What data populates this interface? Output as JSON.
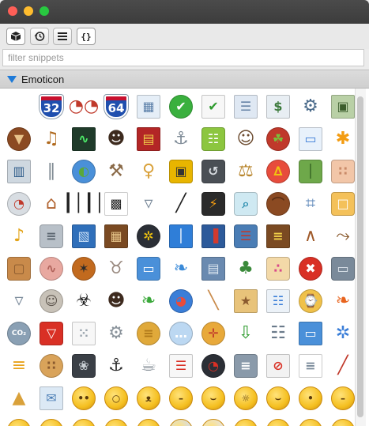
{
  "window": {
    "traffic_lights": [
      "close",
      "minimize",
      "maximize"
    ]
  },
  "toolbar": {
    "tabs": [
      {
        "icon": "cube-icon",
        "active": true
      },
      {
        "icon": "history-icon",
        "active": false
      },
      {
        "icon": "list-icon",
        "active": false
      },
      {
        "icon": "json-icon",
        "glyph": "{}",
        "active": true
      }
    ]
  },
  "filter": {
    "placeholder": "filter snippets",
    "value": ""
  },
  "section": {
    "title": "Emoticon",
    "expanded": true
  },
  "icons": [
    {
      "name": "blank-icon",
      "kind": "none"
    },
    {
      "name": "interstate-32-shield-icon",
      "kind": "shield",
      "text": "32",
      "bg": "#1f4fae",
      "fg": "#c8102e"
    },
    {
      "name": "3d-glasses-icon",
      "kind": "glyph",
      "glyph": "◔◔",
      "bg": "transparent",
      "fg": "#c0392b"
    },
    {
      "name": "interstate-64-shield-icon",
      "kind": "shield",
      "text": "64",
      "bg": "#1f4fae",
      "fg": "#c8102e"
    },
    {
      "name": "circuit-board-icon",
      "kind": "card",
      "bg": "#e5eef7",
      "fg": "#5b7fa8",
      "glyph": "▦"
    },
    {
      "name": "green-check-icon",
      "kind": "round",
      "bg": "#3ab03e",
      "fg": "#ffffff",
      "glyph": "✔"
    },
    {
      "name": "document-check-icon",
      "kind": "card",
      "bg": "#f7f7f7",
      "fg": "#2e9b2e",
      "glyph": "✔"
    },
    {
      "name": "table-rows-icon",
      "kind": "card",
      "bg": "#dfe8f3",
      "fg": "#6683a6",
      "glyph": "☰"
    },
    {
      "name": "people-money-icon",
      "kind": "card",
      "bg": "#e8eef3",
      "fg": "#3c7a3c",
      "glyph": "$"
    },
    {
      "name": "user-gear-icon",
      "kind": "glyph",
      "bg": "transparent",
      "fg": "#4a6a8a",
      "glyph": "⚙"
    },
    {
      "name": "user-photos-icon",
      "kind": "card",
      "bg": "#b9d0a6",
      "fg": "#3b5d2c",
      "glyph": "▣"
    },
    {
      "name": "acorn-icon",
      "kind": "round",
      "bg": "#8b4a22",
      "fg": "#e8c38a",
      "glyph": "▼"
    },
    {
      "name": "guitar-icon",
      "kind": "glyph",
      "bg": "transparent",
      "fg": "#b06a1f",
      "glyph": "♫"
    },
    {
      "name": "heart-monitor-icon",
      "kind": "card",
      "bg": "#1f3b2a",
      "fg": "#4ef06a",
      "glyph": "∿"
    },
    {
      "name": "businessman-icon",
      "kind": "glyph",
      "bg": "transparent",
      "fg": "#3d2a1e",
      "glyph": "☻"
    },
    {
      "name": "network-card-icon",
      "kind": "card",
      "bg": "#b32626",
      "fg": "#f2d24a",
      "glyph": "▤"
    },
    {
      "name": "anchor-icon",
      "kind": "glyph",
      "bg": "transparent",
      "fg": "#7d8a96",
      "glyph": "⚓"
    },
    {
      "name": "android-robot-icon",
      "kind": "sq",
      "bg": "#8cc63f",
      "fg": "#ffffff",
      "glyph": "☷"
    },
    {
      "name": "nurse-icon",
      "kind": "glyph",
      "bg": "transparent",
      "fg": "#6b4a2e",
      "glyph": "☺"
    },
    {
      "name": "apple-icon",
      "kind": "round",
      "bg": "#c0392b",
      "fg": "#7bbf3a",
      "glyph": "☘"
    },
    {
      "name": "window-icon",
      "kind": "card",
      "bg": "#e8f1fb",
      "fg": "#3b7dd8",
      "glyph": "▭"
    },
    {
      "name": "asterisk-icon",
      "kind": "glyph",
      "bg": "transparent",
      "fg": "#f39c12",
      "glyph": "✱"
    },
    {
      "name": "atm-machine-icon",
      "kind": "card",
      "bg": "#cfd8e0",
      "fg": "#2e5c8a",
      "glyph": "▥"
    },
    {
      "name": "paperclip-icon",
      "kind": "glyph",
      "bg": "transparent",
      "fg": "#7f8a93",
      "glyph": "∥"
    },
    {
      "name": "globe-chart-icon",
      "kind": "round",
      "bg": "#4a90d9",
      "fg": "#5aa83a",
      "glyph": "◐"
    },
    {
      "name": "axe-icon",
      "kind": "glyph",
      "bg": "transparent",
      "fg": "#8a6a48",
      "glyph": "⚒"
    },
    {
      "name": "baby-bottle-icon",
      "kind": "glyph",
      "bg": "transparent",
      "fg": "#d9a13a",
      "glyph": "♀"
    },
    {
      "name": "backpack-icon",
      "kind": "sq",
      "bg": "#e8b500",
      "fg": "#333333",
      "glyph": "▣"
    },
    {
      "name": "time-machine-disk-icon",
      "kind": "sq",
      "bg": "#4a4f55",
      "fg": "#d7dbe0",
      "glyph": "↺"
    },
    {
      "name": "balance-scale-icon",
      "kind": "glyph",
      "bg": "transparent",
      "fg": "#b8862e",
      "glyph": "⚖"
    },
    {
      "name": "hot-air-balloon-icon",
      "kind": "round",
      "bg": "#e74c3c",
      "fg": "#f1c40f",
      "glyph": "∆"
    },
    {
      "name": "bamboo-icon",
      "kind": "sq",
      "bg": "#6ea84a",
      "fg": "#2e5a1e",
      "glyph": "│"
    },
    {
      "name": "bandage-icon",
      "kind": "sq",
      "bg": "#f2c6a8",
      "fg": "#c98a68",
      "glyph": "∷"
    },
    {
      "name": "pressure-gauge-icon",
      "kind": "round",
      "bg": "#d8dde2",
      "fg": "#c0392b",
      "glyph": "◔"
    },
    {
      "name": "bank-building-icon",
      "kind": "glyph",
      "bg": "transparent",
      "fg": "#b0622e",
      "glyph": "⌂"
    },
    {
      "name": "barcode-icon",
      "kind": "glyph",
      "bg": "transparent",
      "fg": "#222222",
      "glyph": "┃│┃│"
    },
    {
      "name": "qr-code-icon",
      "kind": "card",
      "bg": "#ffffff",
      "fg": "#222222",
      "glyph": "▩"
    },
    {
      "name": "shopping-basket-icon",
      "kind": "glyph",
      "bg": "transparent",
      "fg": "#7a8a9a",
      "glyph": "▿"
    },
    {
      "name": "baton-icon",
      "kind": "glyph",
      "bg": "transparent",
      "fg": "#222222",
      "glyph": "╱"
    },
    {
      "name": "battery-icon",
      "kind": "sq",
      "bg": "#2b2b2b",
      "fg": "#f39c12",
      "glyph": "⚡"
    },
    {
      "name": "beaker-icon",
      "kind": "sq",
      "bg": "#cfe9f2",
      "fg": "#2e8fb0",
      "glyph": "⌕"
    },
    {
      "name": "bean-icon",
      "kind": "round",
      "bg": "#8b4a22",
      "fg": "#5a2e14",
      "glyph": "⌒"
    },
    {
      "name": "bed-icon",
      "kind": "glyph",
      "bg": "transparent",
      "fg": "#5b86b8",
      "glyph": "⌗"
    },
    {
      "name": "beer-glass-icon",
      "kind": "sq",
      "bg": "#f4c15a",
      "fg": "#ffffff",
      "glyph": "□"
    },
    {
      "name": "bell-icon",
      "kind": "glyph",
      "bg": "transparent",
      "fg": "#e3a41a",
      "glyph": "♪"
    },
    {
      "name": "garbage-bin-icon",
      "kind": "sq",
      "bg": "#b8c0c8",
      "fg": "#5b6670",
      "glyph": "≡"
    },
    {
      "name": "blueprint-icon",
      "kind": "card",
      "bg": "#2f6fba",
      "fg": "#cde2f7",
      "glyph": "▧"
    },
    {
      "name": "board-game-icon",
      "kind": "card",
      "bg": "#7a4a22",
      "fg": "#e7c58a",
      "glyph": "▦"
    },
    {
      "name": "bomb-icon",
      "kind": "round",
      "bg": "#2b2f36",
      "fg": "#f1c40f",
      "glyph": "✲"
    },
    {
      "name": "blue-book-icon",
      "kind": "card",
      "bg": "#2f7ed8",
      "fg": "#ffffff",
      "glyph": "│"
    },
    {
      "name": "book-red-bookmark-icon",
      "kind": "card",
      "bg": "#2d5a9a",
      "fg": "#d33a2e",
      "glyph": "▐"
    },
    {
      "name": "books-stack-icon",
      "kind": "sq",
      "bg": "#4a7db5",
      "fg": "#c0392b",
      "glyph": "☰"
    },
    {
      "name": "bookshelf-icon",
      "kind": "card",
      "bg": "#7a4a22",
      "fg": "#f2d24a",
      "glyph": "≡"
    },
    {
      "name": "boomerang-icon",
      "kind": "glyph",
      "bg": "transparent",
      "fg": "#a05a2a",
      "glyph": "∧"
    },
    {
      "name": "bow-arrow-icon",
      "kind": "glyph",
      "bg": "transparent",
      "fg": "#8a5a2e",
      "glyph": "⤳"
    },
    {
      "name": "wooden-box-icon",
      "kind": "sq",
      "bg": "#c98a4a",
      "fg": "#8a5a2e",
      "glyph": "▢"
    },
    {
      "name": "brain-icon",
      "kind": "round",
      "bg": "#e8a8a0",
      "fg": "#b0625a",
      "glyph": "∿"
    },
    {
      "name": "bug-icon",
      "kind": "round",
      "bg": "#c26a1e",
      "fg": "#2b2b2b",
      "glyph": "✶"
    },
    {
      "name": "bunny-icon",
      "kind": "glyph",
      "bg": "transparent",
      "fg": "#9a8a80",
      "glyph": "♉"
    },
    {
      "name": "bus-icon",
      "kind": "sq",
      "bg": "#4a90d9",
      "fg": "#ffffff",
      "glyph": "▭"
    },
    {
      "name": "butterfly-icon",
      "kind": "glyph",
      "bg": "transparent",
      "fg": "#3a8ad8",
      "glyph": "❧"
    },
    {
      "name": "building-icon",
      "kind": "card",
      "bg": "#6a8ab0",
      "fg": "#dce6f0",
      "glyph": "▤"
    },
    {
      "name": "cactus-icon",
      "kind": "glyph",
      "bg": "transparent",
      "fg": "#3a8a3a",
      "glyph": "♣"
    },
    {
      "name": "birthday-cake-icon",
      "kind": "sq",
      "bg": "#f3d9a8",
      "fg": "#d94a8a",
      "glyph": "∴"
    },
    {
      "name": "cancel-icon",
      "kind": "round",
      "bg": "#d93025",
      "fg": "#ffffff",
      "glyph": "✖"
    },
    {
      "name": "car-icon",
      "kind": "sq",
      "bg": "#7a8a9a",
      "fg": "#dfe6ec",
      "glyph": "▭"
    },
    {
      "name": "shopping-cart-icon",
      "kind": "glyph",
      "bg": "transparent",
      "fg": "#7a8a9a",
      "glyph": "▿"
    },
    {
      "name": "cat-icon",
      "kind": "round",
      "bg": "#c8c2b8",
      "fg": "#5a524a",
      "glyph": "☺"
    },
    {
      "name": "biohazard-icon",
      "kind": "glyph",
      "bg": "transparent",
      "fg": "#222222",
      "glyph": "☣"
    },
    {
      "name": "manager-icon",
      "kind": "glyph",
      "bg": "transparent",
      "fg": "#3d2a1e",
      "glyph": "☻"
    },
    {
      "name": "chameleon-icon",
      "kind": "glyph",
      "bg": "transparent",
      "fg": "#3aa83a",
      "glyph": "❧"
    },
    {
      "name": "pie-chart-icon",
      "kind": "round",
      "bg": "#3a7ed8",
      "fg": "#e74c3c",
      "glyph": "◕"
    },
    {
      "name": "cigarette-icon",
      "kind": "glyph",
      "bg": "transparent",
      "fg": "#c98a4a",
      "glyph": "╲"
    },
    {
      "name": "cinema-ticket-icon",
      "kind": "card",
      "bg": "#e8c37a",
      "fg": "#8a5a2e",
      "glyph": "★"
    },
    {
      "name": "network-diagram-icon",
      "kind": "card",
      "bg": "#ecf2f8",
      "fg": "#3a7ed8",
      "glyph": "☷"
    },
    {
      "name": "alarm-clock-icon",
      "kind": "round",
      "bg": "#f0c14a",
      "fg": "#2a4a8a",
      "glyph": "⌚"
    },
    {
      "name": "clownfish-icon",
      "kind": "glyph",
      "bg": "transparent",
      "fg": "#e8641e",
      "glyph": "❧"
    },
    {
      "name": "co2-cloud-icon",
      "kind": "round",
      "bg": "#8aa0b4",
      "fg": "#ffffff",
      "glyph": "CO₂"
    },
    {
      "name": "red-cup-icon",
      "kind": "sq",
      "bg": "#d93025",
      "fg": "#ffffff",
      "glyph": "▽"
    },
    {
      "name": "dot-grid-icon",
      "kind": "card",
      "bg": "#f7f7f7",
      "fg": "#9aa4ad",
      "glyph": "⁙"
    },
    {
      "name": "cog-icon",
      "kind": "glyph",
      "bg": "transparent",
      "fg": "#8a939b",
      "glyph": "⚙"
    },
    {
      "name": "coins-stack-icon",
      "kind": "round",
      "bg": "#e0a93a",
      "fg": "#b07a1a",
      "glyph": "≡"
    },
    {
      "name": "speech-bubble-icon",
      "kind": "round",
      "bg": "#bcd8f2",
      "fg": "#ffffff",
      "glyph": "…"
    },
    {
      "name": "compass-icon",
      "kind": "round",
      "bg": "#e8a93a",
      "fg": "#c0392b",
      "glyph": "✛"
    },
    {
      "name": "binary-download-icon",
      "kind": "glyph",
      "bg": "transparent",
      "fg": "#2e9b2e",
      "glyph": "⇩"
    },
    {
      "name": "hierarchy-icon",
      "kind": "glyph",
      "bg": "transparent",
      "fg": "#6a7a8a",
      "glyph": "☷"
    },
    {
      "name": "computer-network-icon",
      "kind": "card",
      "bg": "#4a90d9",
      "fg": "#ffffff",
      "glyph": "▭"
    },
    {
      "name": "connector-icon",
      "kind": "glyph",
      "bg": "transparent",
      "fg": "#3a7ed8",
      "glyph": "✲"
    },
    {
      "name": "barrier-icon",
      "kind": "glyph",
      "bg": "transparent",
      "fg": "#e8a21a",
      "glyph": "≡"
    },
    {
      "name": "cookies-icon",
      "kind": "round",
      "bg": "#d9a35a",
      "fg": "#8a5a2e",
      "glyph": "∷"
    },
    {
      "name": "cpu-fan-icon",
      "kind": "sq",
      "bg": "#3a3f46",
      "fg": "#c8ced4",
      "glyph": "❀"
    },
    {
      "name": "cruise-ship-icon",
      "kind": "glyph",
      "bg": "transparent",
      "fg": "#2b2b2b",
      "glyph": "⚓"
    },
    {
      "name": "cup-icon",
      "kind": "glyph",
      "bg": "transparent",
      "fg": "#8a939b",
      "glyph": "☕"
    },
    {
      "name": "report-icon",
      "kind": "card",
      "bg": "#f7f7f7",
      "fg": "#d93025",
      "glyph": "☰"
    },
    {
      "name": "dashboard-gauge-icon",
      "kind": "round",
      "bg": "#2b2f36",
      "fg": "#d93025",
      "glyph": "◔"
    },
    {
      "name": "database-icon",
      "kind": "sq",
      "bg": "#8a9aaa",
      "fg": "#ffffff",
      "glyph": "≡"
    },
    {
      "name": "do-not-disturb-icon",
      "kind": "card",
      "bg": "#f2f2f2",
      "fg": "#d93025",
      "glyph": "⊘"
    },
    {
      "name": "text-document-icon",
      "kind": "card",
      "bg": "#ffffff",
      "fg": "#7a8a9a",
      "glyph": "≡"
    },
    {
      "name": "dynamite-icon",
      "kind": "glyph",
      "bg": "transparent",
      "fg": "#c0392b",
      "glyph": "╱"
    },
    {
      "name": "pyramid-icon",
      "kind": "glyph",
      "bg": "transparent",
      "fg": "#d9a13a",
      "glyph": "▲"
    },
    {
      "name": "envelope-icon",
      "kind": "card",
      "bg": "#dce9f5",
      "fg": "#4a7db5",
      "glyph": "✉"
    },
    {
      "name": "emoticon-wide-eyed",
      "kind": "smile",
      "glyph": "••"
    },
    {
      "name": "emoticon-surprised",
      "kind": "smile",
      "glyph": "○"
    },
    {
      "name": "emoticon-vampire",
      "kind": "smile",
      "glyph": "ᴥ"
    },
    {
      "name": "emoticon-annoyed",
      "kind": "smile",
      "glyph": "–"
    },
    {
      "name": "emoticon-smirk",
      "kind": "smile",
      "glyph": "⌣"
    },
    {
      "name": "emoticon-beach",
      "kind": "smile",
      "glyph": "☼"
    },
    {
      "name": "emoticon-wink",
      "kind": "smile",
      "glyph": "⌣"
    },
    {
      "name": "emoticon-black-eye",
      "kind": "smile",
      "glyph": "•"
    },
    {
      "name": "emoticon-neutral",
      "kind": "smile",
      "glyph": "–"
    },
    {
      "name": "emoticon-sunglasses",
      "kind": "smile",
      "glyph": "▬"
    },
    {
      "name": "emoticon-crying",
      "kind": "smile",
      "glyph": "○"
    },
    {
      "name": "emoticon-clown",
      "kind": "smile",
      "glyph": "●"
    },
    {
      "name": "emoticon-sobbing",
      "kind": "smile",
      "glyph": "◠"
    },
    {
      "name": "emoticon-shocked",
      "kind": "smile",
      "glyph": "○"
    },
    {
      "name": "emoticon-ghost",
      "kind": "smile",
      "glyph": "○",
      "bg": "#d8dde2"
    },
    {
      "name": "emoticon-old-man",
      "kind": "smile",
      "glyph": "⌣",
      "bg": "#e8e3da"
    },
    {
      "name": "emoticon-kiss",
      "kind": "smile",
      "glyph": "•"
    },
    {
      "name": "emoticon-laughing",
      "kind": "smile",
      "glyph": "◡"
    },
    {
      "name": "emoticon-grimace",
      "kind": "smile",
      "glyph": "≡"
    },
    {
      "name": "emoticon-mask",
      "kind": "smile",
      "glyph": "▭"
    }
  ],
  "palette": {
    "emoticon_yellow": "#f5c021",
    "emoticon_outline": "#c98a0e",
    "accent_blue": "#1e7ad8"
  }
}
